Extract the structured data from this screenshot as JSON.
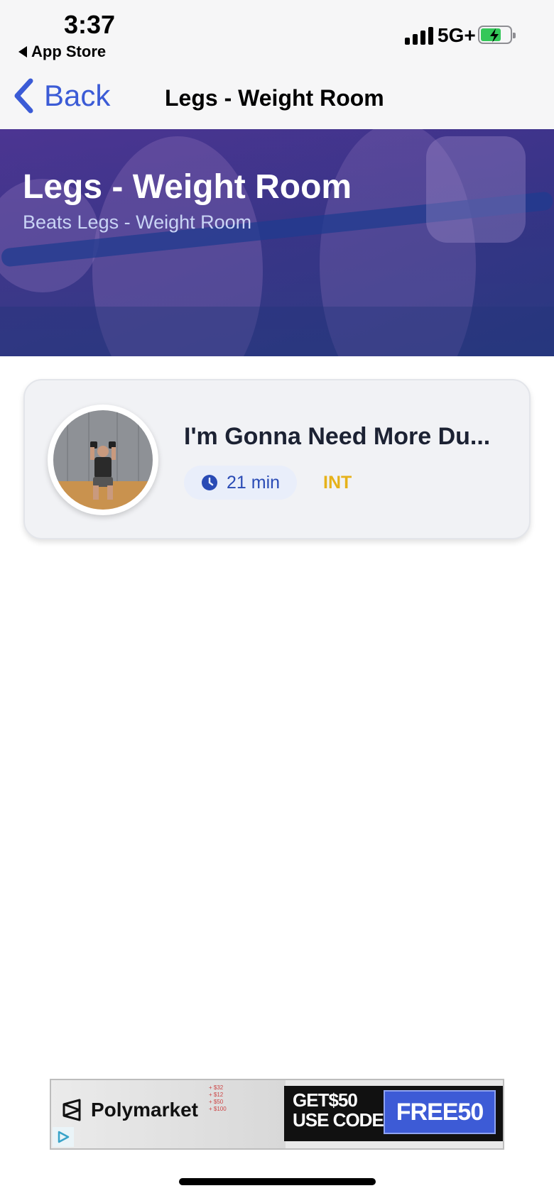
{
  "status_bar": {
    "time": "3:37",
    "back_app": "App Store",
    "network": "5G+"
  },
  "nav": {
    "back_label": "Back",
    "title": "Legs - Weight Room"
  },
  "hero": {
    "title": "Legs - Weight Room",
    "subtitle": "Beats Legs - Weight Room"
  },
  "workouts": [
    {
      "title": "I'm Gonna Need More Du...",
      "duration": "21 min",
      "level": "INT"
    }
  ],
  "ad": {
    "brand": "Polymarket",
    "prices": [
      "+ $32",
      "+ $12",
      "+ $50",
      "+ $100"
    ],
    "promo_line1": "GET$50",
    "promo_line2": "USE CODE",
    "code": "FREE50"
  },
  "colors": {
    "accent": "#3b5bd6",
    "level": "#e6b21a",
    "hero": "#2c2b7a"
  }
}
